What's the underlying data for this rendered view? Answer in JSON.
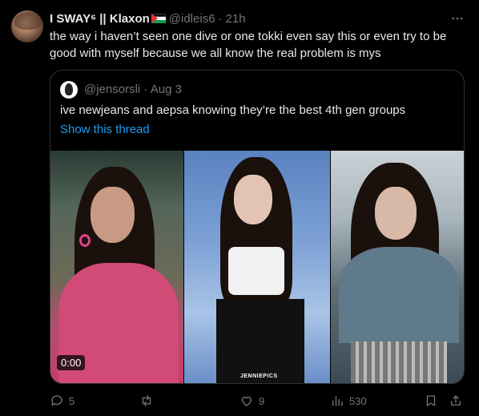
{
  "tweet": {
    "display_name": "I SWAY⁶ || Klaxon",
    "handle": "@idleis6",
    "separator": "·",
    "time": "21h",
    "more_icon": "more-horizontal-icon",
    "text_lines": [
      "the way i haven’t seen one dive or one tokki even say this or even try to be",
      "good with myself because we all know the real problem is mys"
    ]
  },
  "quote": {
    "handle": "@jensorsli",
    "separator": "·",
    "date": "Aug 3",
    "text": "ive newjeans and aepsa knowing they’re the best 4th gen groups",
    "show_thread": "Show this thread",
    "media": {
      "video_time": "0:00",
      "watermark": "JENNIEPICS"
    }
  },
  "actions": {
    "reply": {
      "icon": "reply-icon",
      "count": "5"
    },
    "repost": {
      "icon": "repost-icon",
      "count": ""
    },
    "like": {
      "icon": "heart-icon",
      "count": "9"
    },
    "views": {
      "icon": "views-icon",
      "count": "530"
    },
    "bookmark": {
      "icon": "bookmark-icon"
    },
    "share": {
      "icon": "share-icon"
    }
  },
  "colors": {
    "background": "#000000",
    "text": "#e7e9ea",
    "muted": "#71767b",
    "link": "#1d9bf0",
    "border": "#2f3336"
  }
}
